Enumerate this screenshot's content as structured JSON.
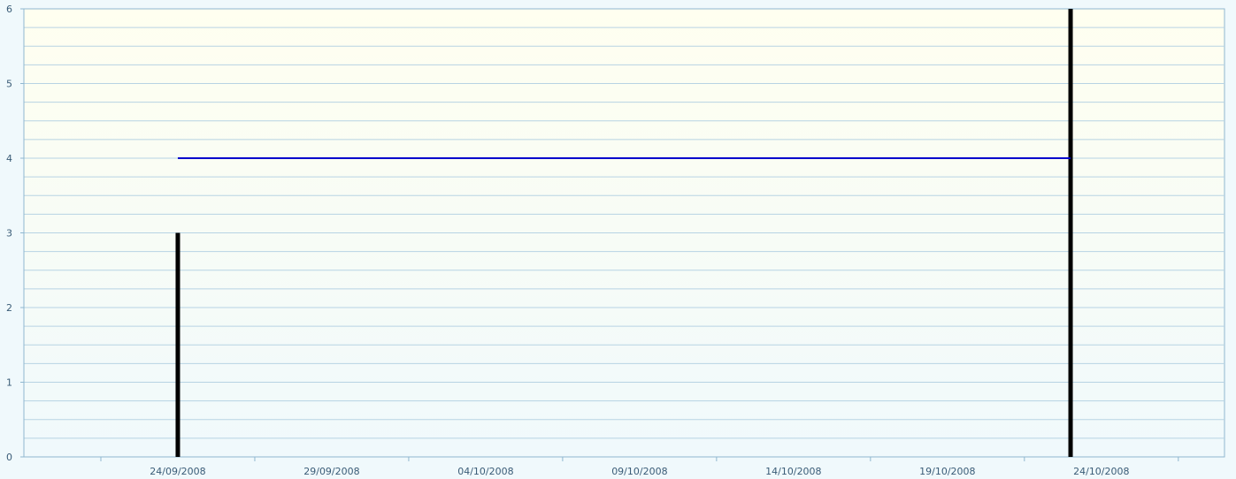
{
  "chart_data": {
    "type": "bar",
    "title": "",
    "xlabel": "",
    "ylabel": "",
    "ylim": [
      0,
      6
    ],
    "yticks": [
      "0",
      "1",
      "2",
      "3",
      "4",
      "5",
      "6"
    ],
    "xlim": [
      "2008-09-19",
      "2008-10-28"
    ],
    "xticks": [
      "24/09/2008",
      "29/09/2008",
      "04/10/2008",
      "09/10/2008",
      "14/10/2008",
      "19/10/2008",
      "24/10/2008"
    ],
    "grid": true,
    "legend": "none",
    "series": [
      {
        "type": "bar",
        "color": "#000000",
        "points": [
          {
            "x": "2008-09-24",
            "y": 3
          },
          {
            "x": "2008-10-23",
            "y": 6
          }
        ]
      },
      {
        "type": "line",
        "color": "#0000cc",
        "points": [
          {
            "x": "2008-09-24",
            "y": 4
          },
          {
            "x": "2008-10-23",
            "y": 4
          }
        ]
      }
    ],
    "colors": {
      "plot_top": "#fffff0",
      "plot_bottom": "#f0f9fc",
      "grid": "#b7d3e3",
      "axis": "#8fb7cf",
      "label": "#3a5c77"
    }
  }
}
